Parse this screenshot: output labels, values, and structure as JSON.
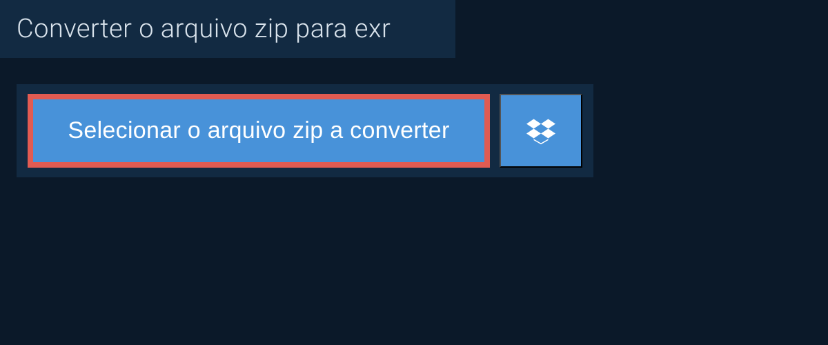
{
  "header": {
    "title": "Converter o arquivo zip para exr"
  },
  "upload": {
    "select_label": "Selecionar o arquivo zip a converter",
    "dropbox_icon": "dropbox-icon"
  }
}
